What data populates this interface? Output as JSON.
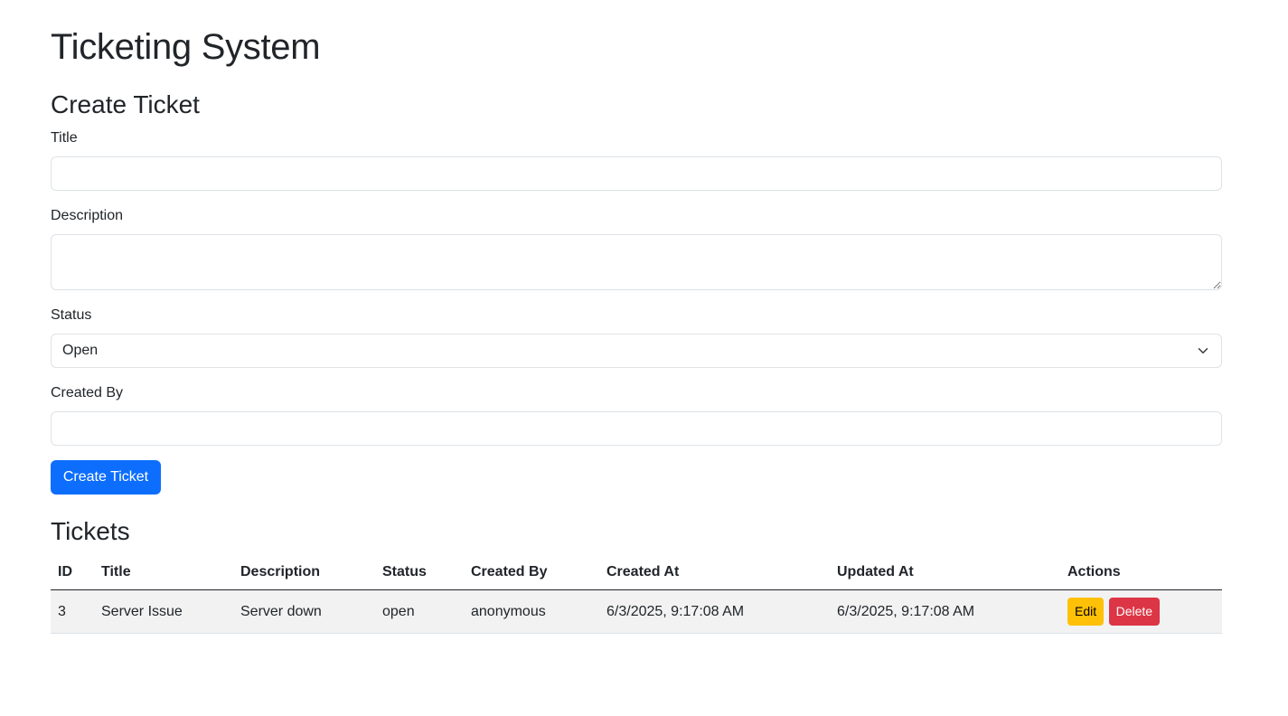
{
  "page": {
    "title": "Ticketing System"
  },
  "create_form": {
    "heading": "Create Ticket",
    "title_label": "Title",
    "title_value": "",
    "description_label": "Description",
    "description_value": "",
    "status_label": "Status",
    "status_selected": "Open",
    "created_by_label": "Created By",
    "created_by_value": "",
    "submit_label": "Create Ticket"
  },
  "tickets": {
    "heading": "Tickets",
    "columns": [
      "ID",
      "Title",
      "Description",
      "Status",
      "Created By",
      "Created At",
      "Updated At",
      "Actions"
    ],
    "rows": [
      {
        "id": "3",
        "title": "Server Issue",
        "description": "Server down",
        "status": "open",
        "created_by": "anonymous",
        "created_at": "6/3/2025, 9:17:08 AM",
        "updated_at": "6/3/2025, 9:17:08 AM",
        "edit_label": "Edit",
        "delete_label": "Delete"
      }
    ]
  },
  "colors": {
    "primary": "#0d6efd",
    "warning": "#ffc107",
    "danger": "#dc3545"
  },
  "icons": {
    "status_dropdown": "chevron-down-icon"
  }
}
